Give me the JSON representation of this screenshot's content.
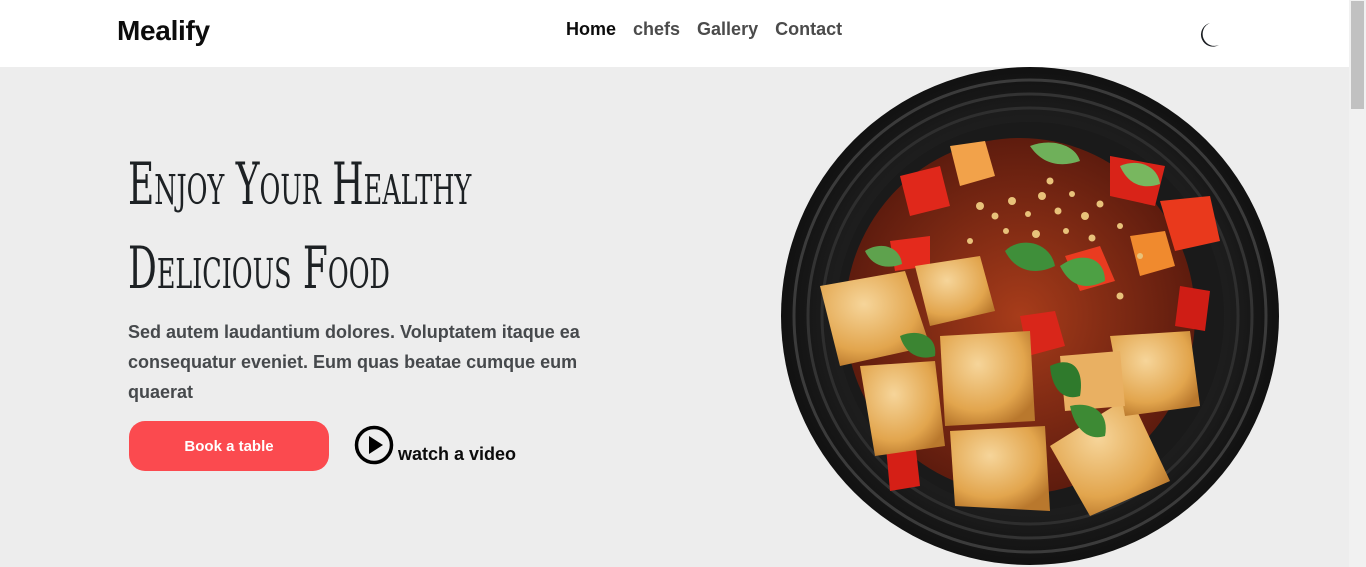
{
  "header": {
    "brand": "Mealify",
    "nav": [
      {
        "label": "Home",
        "active": true
      },
      {
        "label": "chefs",
        "active": false
      },
      {
        "label": "Gallery",
        "active": false
      },
      {
        "label": "Contact",
        "active": false
      }
    ],
    "theme_icon": "moon-icon"
  },
  "hero": {
    "title_line1": "Enjoy Your Healthy",
    "title_line2": "Delicious Food",
    "description": "Sed autem laudantium dolores. Voluptatem itaque ea consequatur eveniet. Eum quas beatae cumque eum quaerat",
    "book_button": "Book a table",
    "video_label": "watch a video",
    "video_icon": "play-circle-icon"
  },
  "image": {
    "icon": "food-plate-image"
  },
  "colors": {
    "accent": "#fb4a4f",
    "background": "#ededed",
    "header_bg": "#ffffff",
    "text_dark": "#0c0c0c",
    "text_muted": "#46494c"
  }
}
